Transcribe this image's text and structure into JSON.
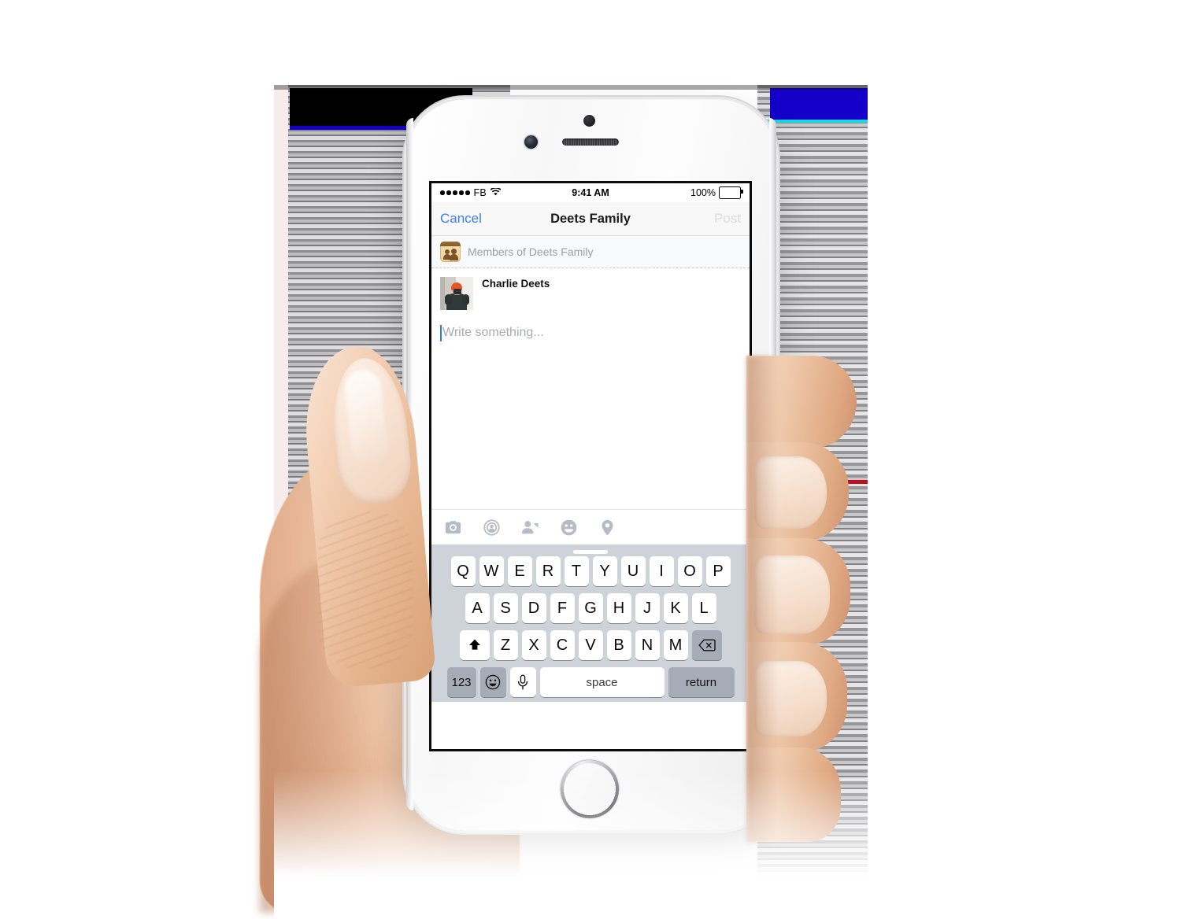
{
  "device": {
    "name": "iPhone",
    "color": "white-silver",
    "hardware": {
      "front_camera": "front-camera",
      "earpiece": "earpiece-speaker",
      "proximity_sensor": "proximity-sensor",
      "home_button": "home-button"
    }
  },
  "status_bar": {
    "signal_dots": 5,
    "carrier": "FB",
    "wifi_icon": "wifi-icon",
    "time": "9:41 AM",
    "battery_percent": "100%",
    "battery_icon": "battery-full-icon"
  },
  "nav_bar": {
    "cancel_label": "Cancel",
    "title": "Deets Family",
    "post_label": "Post",
    "post_enabled": false,
    "cancel_color": "#3b7ef0",
    "post_color": "#dadbdd"
  },
  "audience": {
    "icon": "group-members-icon",
    "label": "Members of Deets Family"
  },
  "composer": {
    "avatar": "user-avatar",
    "author_name": "Charlie Deets",
    "placeholder": "Write something...",
    "value": "",
    "caret_color": "#2f7bf0"
  },
  "attachments": [
    {
      "name": "camera-icon",
      "label": "Photo"
    },
    {
      "name": "live-video-icon",
      "label": "Live Video"
    },
    {
      "name": "tag-friends-icon",
      "label": "Tag Friends"
    },
    {
      "name": "feeling-icon",
      "label": "Feeling/Activity"
    },
    {
      "name": "location-pin-icon",
      "label": "Check In"
    }
  ],
  "keyboard": {
    "handle": "keyboard-drag-handle",
    "row1": [
      "Q",
      "W",
      "E",
      "R",
      "T",
      "Y",
      "U",
      "I",
      "O",
      "P"
    ],
    "row2": [
      "A",
      "S",
      "D",
      "F",
      "G",
      "H",
      "J",
      "K",
      "L"
    ],
    "row3": [
      "Z",
      "X",
      "C",
      "V",
      "B",
      "N",
      "M"
    ],
    "shift_icon": "shift-icon",
    "backspace_icon": "backspace-icon",
    "numbers_label": "123",
    "emoji_icon": "emoji-icon",
    "mic_icon": "microphone-icon",
    "space_label": "space",
    "return_label": "return",
    "background_color": "#ced3da",
    "key_color": "#ffffff",
    "modifier_key_color": "#a6acb6"
  }
}
